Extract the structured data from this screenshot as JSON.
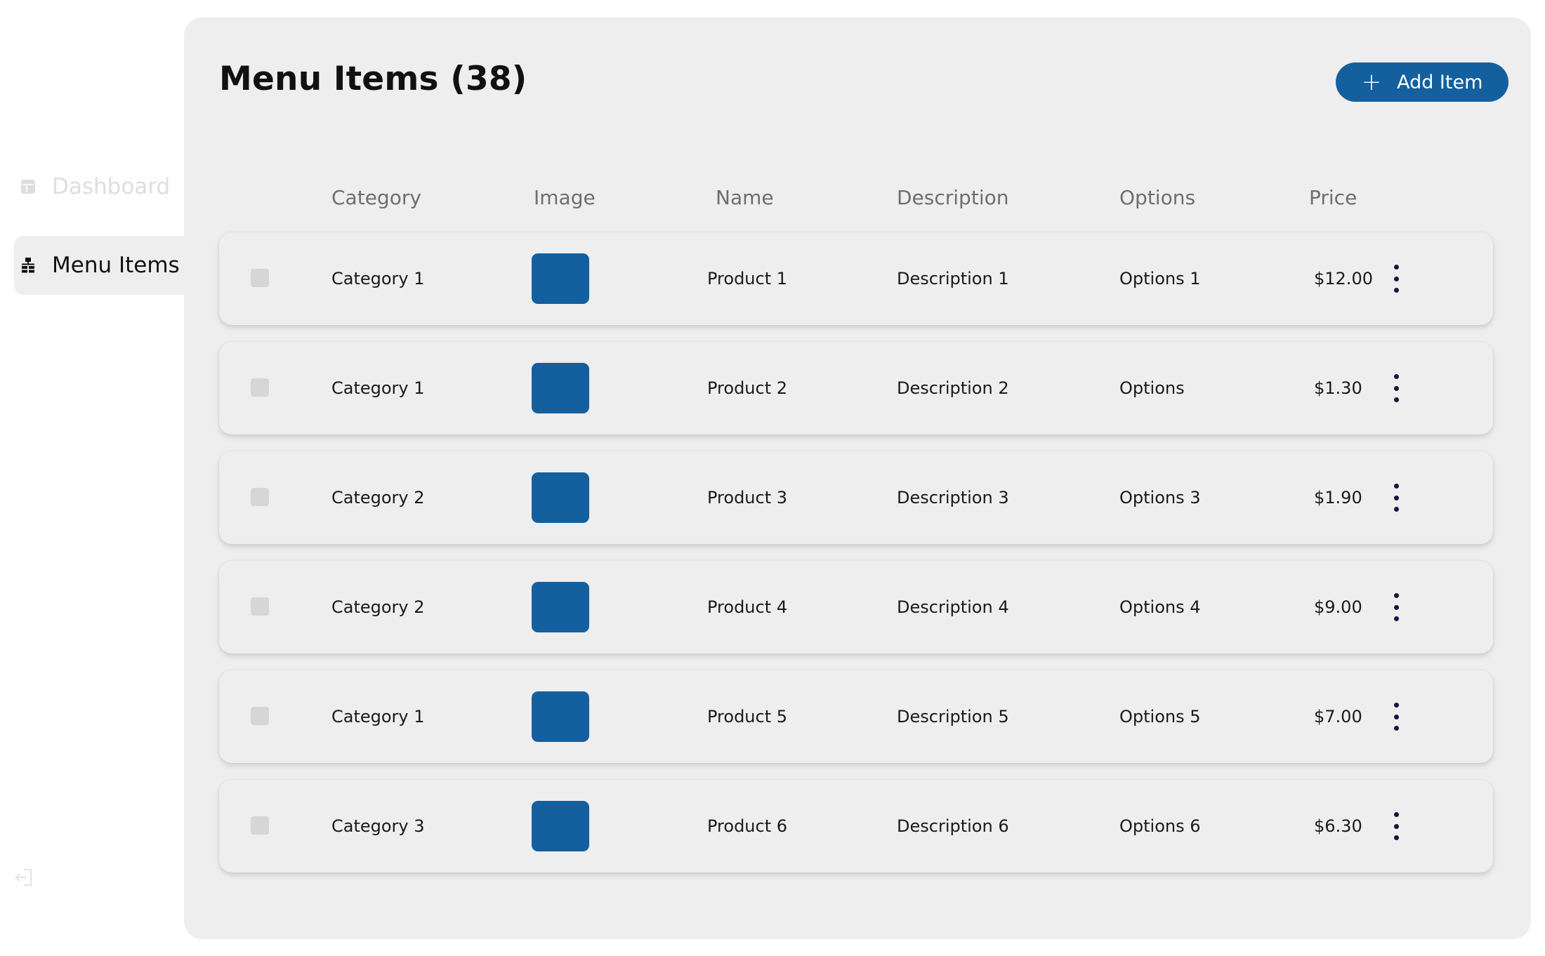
{
  "sidebar": {
    "items": [
      {
        "label": "Dashboard",
        "icon": "dashboard-icon",
        "active": false
      },
      {
        "label": "Menu Items",
        "icon": "menu-items-icon",
        "active": true
      }
    ],
    "logout_icon": "logout-icon"
  },
  "header": {
    "title": "Menu Items (38)",
    "add_button_label": "Add Item"
  },
  "table": {
    "columns": [
      "Category",
      "Image",
      "Name",
      "Description",
      "Options",
      "Price"
    ],
    "rows": [
      {
        "category": "Category 1",
        "name": "Product 1",
        "description": "Description 1",
        "options": "Options 1",
        "price": "$12.00"
      },
      {
        "category": "Category 1",
        "name": "Product 2",
        "description": "Description 2",
        "options": "Options",
        "price": "$1.30"
      },
      {
        "category": "Category 2",
        "name": "Product 3",
        "description": "Description 3",
        "options": "Options 3",
        "price": "$1.90"
      },
      {
        "category": "Category 2",
        "name": "Product 4",
        "description": "Description 4",
        "options": "Options 4",
        "price": "$9.00"
      },
      {
        "category": "Category 1",
        "name": "Product 5",
        "description": "Description 5",
        "options": "Options 5",
        "price": "$7.00"
      },
      {
        "category": "Category 3",
        "name": "Product 6",
        "description": "Description 6",
        "options": "Options 6",
        "price": "$6.30"
      }
    ]
  },
  "colors": {
    "accent": "#14609e",
    "panel_bg": "#eeeeee",
    "kebab": "#1b1340"
  }
}
